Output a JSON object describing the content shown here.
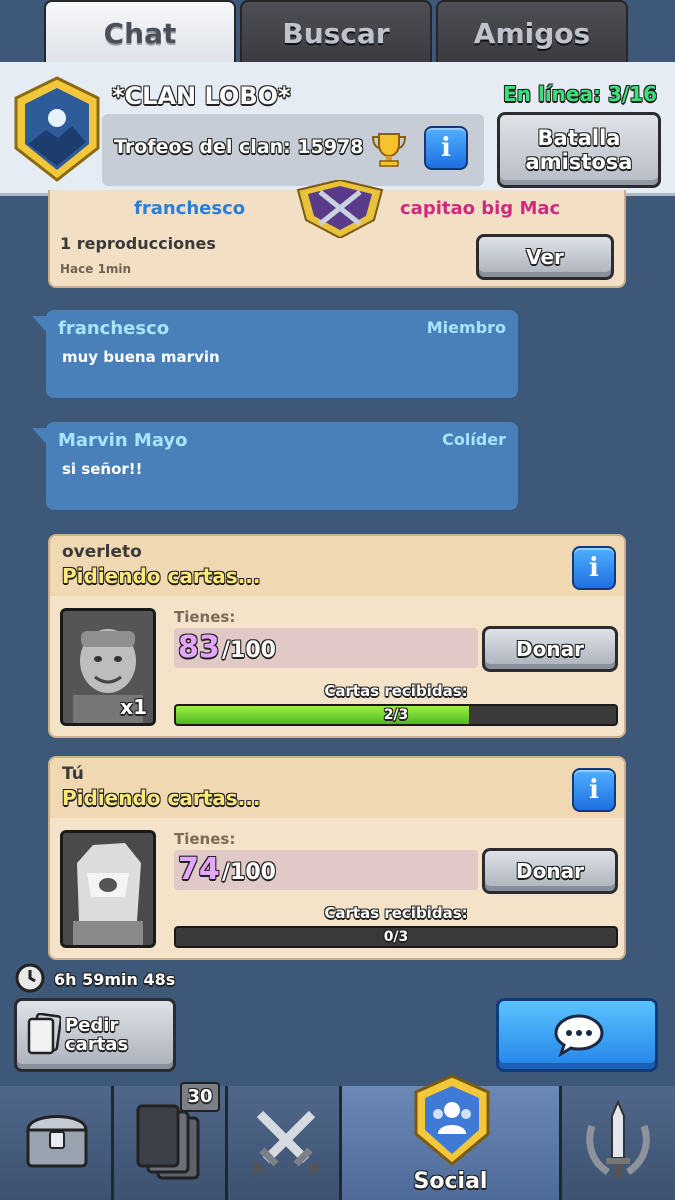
{
  "tabs": [
    {
      "label": "Chat",
      "active": true
    },
    {
      "label": "Buscar",
      "active": false
    },
    {
      "label": "Amigos",
      "active": false
    }
  ],
  "clan": {
    "name": "*CLAN LOBO*",
    "online": "En línea: 3/16",
    "trophies_label": "Trofeos del clan: 15978",
    "friendly_battle_label": "Batalla amistosa"
  },
  "replay": {
    "player1": "franchesco",
    "player2": "capitao big Mac",
    "views": "1 reproducciones",
    "time": "Hace 1min",
    "view_button": "Ver"
  },
  "messages": [
    {
      "name": "franchesco",
      "role": "Miembro",
      "text": "muy buena marvin"
    },
    {
      "name": "Marvin Mayo",
      "role": "Colíder",
      "text": "si señor!!"
    }
  ],
  "requests": [
    {
      "user": "overleto",
      "title": "Pidiendo cartas...",
      "have_label": "Tienes:",
      "have": "83",
      "max": "/100",
      "quantity": "x1",
      "donate_label": "Donar",
      "received_label": "Cartas recibidas:",
      "received_text": "2/3",
      "received_fraction": 0.6667
    },
    {
      "user": "Tú",
      "title": "Pidiendo cartas...",
      "have_label": "Tienes:",
      "have": "74",
      "max": "/100",
      "donate_label": "Donar",
      "received_label": "Cartas recibidas:",
      "received_text": "0/3",
      "received_fraction": 0
    }
  ],
  "timer": "6h 59min 48s",
  "request_button": "Pedir cartas",
  "nav": {
    "cards_badge": "30",
    "social_label": "Social"
  },
  "colors": {
    "background": "#3d5878",
    "bubble": "#4a80ba",
    "accent_blue": "#2483e8",
    "online_green": "#3be07a",
    "progress_green": "#4db81e"
  }
}
